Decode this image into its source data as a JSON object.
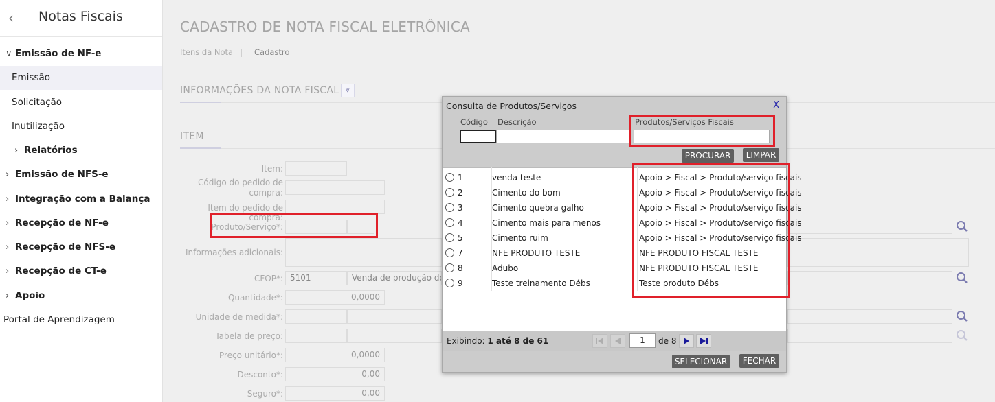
{
  "sidebar": {
    "title": "Notas Fiscais",
    "back_icon": "‹",
    "items": [
      {
        "label": "Emissão de NF-e",
        "chevron": "∨"
      },
      {
        "label": "Emissão"
      },
      {
        "label": "Solicitação"
      },
      {
        "label": "Inutilização"
      },
      {
        "label": "Relatórios",
        "chevron": "›"
      },
      {
        "label": "Emissão de NFS-e",
        "chevron": "›"
      },
      {
        "label": "Integração com a Balança",
        "chevron": "›"
      },
      {
        "label": "Recepção de NF-e",
        "chevron": "›"
      },
      {
        "label": "Recepção de NFS-e",
        "chevron": "›"
      },
      {
        "label": "Recepção de CT-e",
        "chevron": "›"
      },
      {
        "label": "Apoio",
        "chevron": "›"
      },
      {
        "label": "Portal de Aprendizagem"
      }
    ]
  },
  "main": {
    "title": "CADASTRO DE NOTA FISCAL ELETRÔNICA",
    "breadcrumb": [
      "Itens da Nota",
      "Cadastro"
    ],
    "section_info": "INFORMAÇÕES DA NOTA FISCAL",
    "section_item": "ITEM",
    "form": {
      "item_label": "Item:",
      "codigo_pedido_label_1": "Código do pedido de",
      "codigo_pedido_label_2": "compra:",
      "item_pedido_label": "Item do pedido de compra:",
      "produto_label": "Produto/Serviço*:",
      "info_adicionais_label": "Informações adicionais:",
      "cfop_label": "CFOP*:",
      "cfop_value": "5101",
      "cfop_desc": "Venda de produção do es",
      "quantidade_label": "Quantidade*:",
      "quantidade_value": "0,0000",
      "unidade_label": "Unidade de medida*:",
      "tabela_label": "Tabela de preço:",
      "preco_label": "Preço unitário*:",
      "preco_value": "0,0000",
      "desconto_label": "Desconto*:",
      "desconto_value": "0,00",
      "seguro_label": "Seguro*:",
      "seguro_value": "0,00"
    }
  },
  "modal": {
    "title": "Consulta de Produtos/Serviços",
    "close": "X",
    "codigo_label": "Código",
    "descricao_label": "Descrição",
    "fiscal_label": "Produtos/Serviços Fiscais",
    "procurar": "PROCURAR",
    "limpar": "LIMPAR",
    "rows": [
      {
        "code": "1",
        "desc": "venda teste",
        "fiscal": "Apoio > Fiscal > Produto/serviço fiscais"
      },
      {
        "code": "2",
        "desc": "Cimento do bom",
        "fiscal": "Apoio > Fiscal > Produto/serviço fiscais"
      },
      {
        "code": "3",
        "desc": "Cimento quebra galho",
        "fiscal": "Apoio > Fiscal > Produto/serviço fiscais"
      },
      {
        "code": "4",
        "desc": "Cimento mais para menos",
        "fiscal": "Apoio > Fiscal > Produto/serviço fiscais"
      },
      {
        "code": "5",
        "desc": "Cimento ruim",
        "fiscal": "Apoio > Fiscal > Produto/serviço fiscais"
      },
      {
        "code": "7",
        "desc": "NFE PRODUTO TESTE",
        "fiscal": "NFE PRODUTO FISCAL TESTE"
      },
      {
        "code": "8",
        "desc": "Adubo",
        "fiscal": "NFE PRODUTO FISCAL TESTE"
      },
      {
        "code": "9",
        "desc": "Teste treinamento Débs",
        "fiscal": "Teste produto Débs"
      }
    ],
    "exibindo_prefix": "Exibindo:",
    "exibindo_value": "1 até 8 de 61",
    "page": "1",
    "page_of": "de 8",
    "selecionar": "SELECIONAR",
    "fechar": "FECHAR"
  },
  "colors": {
    "highlight": "#e0202a",
    "modal_button": "#5f5f5f",
    "pager_arrow": "#1a1a9a"
  }
}
